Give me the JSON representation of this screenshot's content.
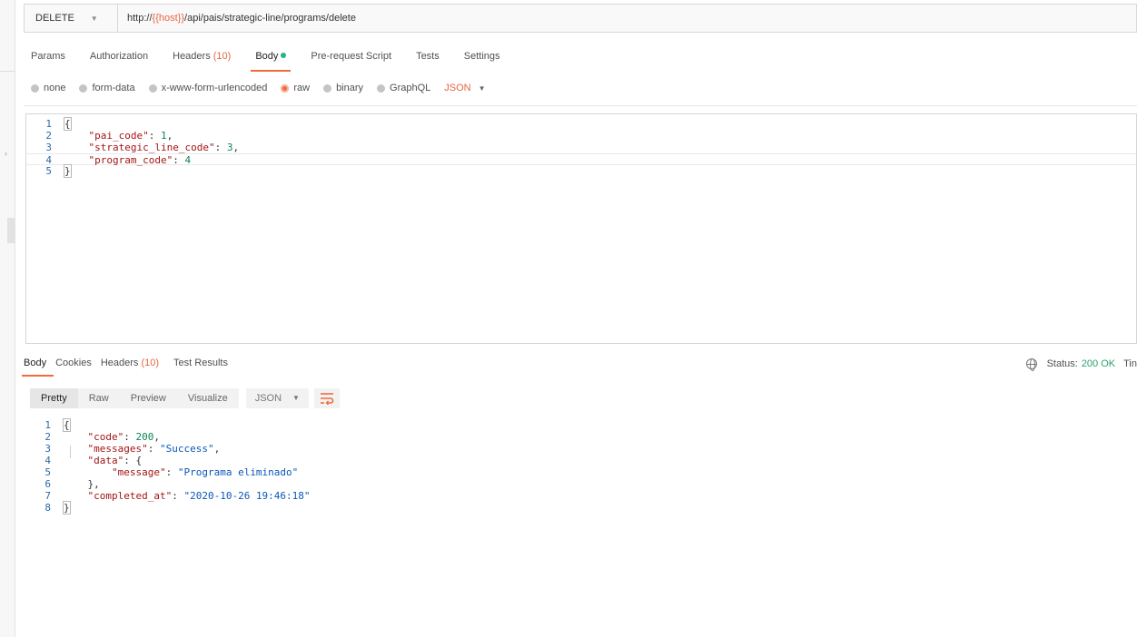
{
  "request": {
    "method": "DELETE",
    "url_prefix": "http://",
    "url_var": "{{host}}",
    "url_path": "/api/pais/strategic-line/programs/delete"
  },
  "req_tabs": {
    "params": "Params",
    "authorization": "Authorization",
    "headers": "Headers",
    "headers_count": "(10)",
    "body": "Body",
    "prerequest": "Pre-request Script",
    "tests": "Tests",
    "settings": "Settings"
  },
  "body_types": {
    "none": "none",
    "form_data": "form-data",
    "urlencoded": "x-www-form-urlencoded",
    "raw": "raw",
    "binary": "binary",
    "graphql": "GraphQL",
    "format": "JSON",
    "selected": "raw"
  },
  "request_body_lines": [
    {
      "n": "1",
      "text": "{"
    },
    {
      "n": "2",
      "key": "\"pai_code\"",
      "val": "1",
      "tail": ","
    },
    {
      "n": "3",
      "key": "\"strategic_line_code\"",
      "val": "3",
      "tail": ","
    },
    {
      "n": "4",
      "key": "\"program_code\"",
      "val": "4",
      "tail": ""
    },
    {
      "n": "5",
      "text": "}"
    }
  ],
  "resp_tabs": {
    "body": "Body",
    "cookies": "Cookies",
    "headers": "Headers",
    "headers_count": "(10)",
    "test_results": "Test Results"
  },
  "status": {
    "label": "Status:",
    "value": "200 OK",
    "time_label": "Tin"
  },
  "view_modes": {
    "pretty": "Pretty",
    "raw": "Raw",
    "preview": "Preview",
    "visualize": "Visualize",
    "format": "JSON"
  },
  "response_body_lines": [
    {
      "n": "1",
      "text": "{"
    },
    {
      "n": "2",
      "key": "\"code\"",
      "val": "200",
      "tail": ","
    },
    {
      "n": "3",
      "key": "\"messages\"",
      "sval": "\"Success\"",
      "tail": ","
    },
    {
      "n": "4",
      "key": "\"data\"",
      "text2": ": {"
    },
    {
      "n": "5",
      "key": "\"message\"",
      "sval": "\"Programa eliminado\"",
      "tail": ""
    },
    {
      "n": "6",
      "text": "},"
    },
    {
      "n": "7",
      "key": "\"completed_at\"",
      "sval": "\"2020-10-26 19:46:18\"",
      "tail": ""
    },
    {
      "n": "8",
      "text": "}"
    }
  ],
  "colors": {
    "accent": "#f26b3a",
    "success": "#26a36e",
    "variable": "#e8653f"
  }
}
